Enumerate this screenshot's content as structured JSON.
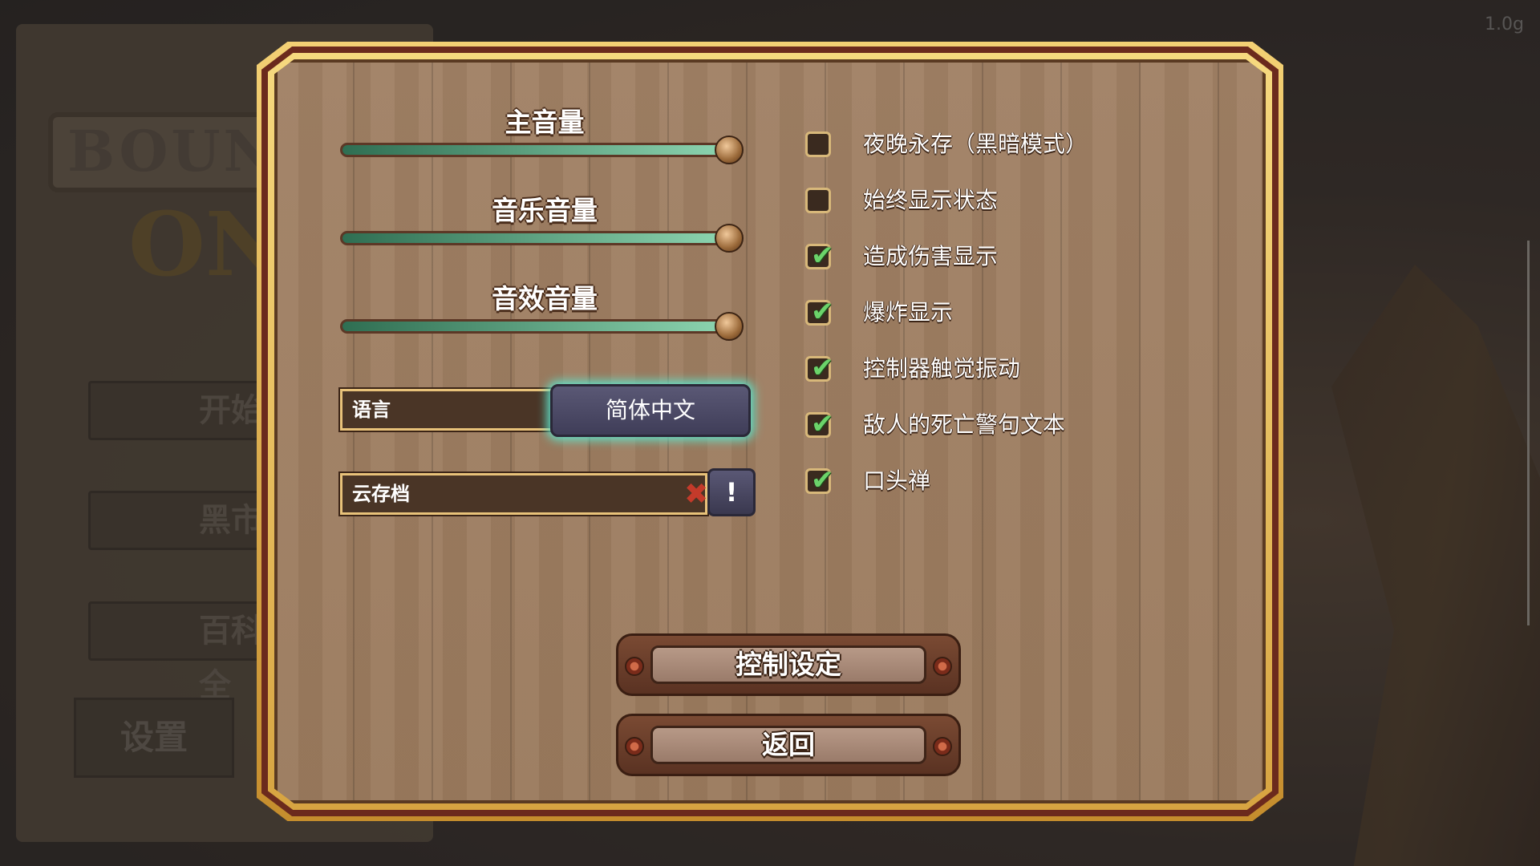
{
  "background": {
    "logo_text": "BOUN",
    "logo_sub": "ON",
    "menu_items": [
      "开始",
      "黑市",
      "百科全"
    ],
    "settings_label": "设置",
    "version": "1.0g"
  },
  "volume": {
    "master": {
      "label": "主音量",
      "level": 1.0
    },
    "music": {
      "label": "音乐音量",
      "level": 1.0
    },
    "sfx": {
      "label": "音效音量",
      "level": 1.0
    }
  },
  "language": {
    "label": "语言",
    "value": "简体中文"
  },
  "cloud_save": {
    "label": "云存档",
    "status_icon": "cross-icon",
    "info_label": "!"
  },
  "options": [
    {
      "label": "夜晚永存（黑暗模式）",
      "checked": false
    },
    {
      "label": "始终显示状态",
      "checked": false
    },
    {
      "label": "造成伤害显示",
      "checked": true
    },
    {
      "label": "爆炸显示",
      "checked": true
    },
    {
      "label": "控制器触觉振动",
      "checked": true
    },
    {
      "label": "敌人的死亡警句文本",
      "checked": true
    },
    {
      "label": "口头禅",
      "checked": true
    }
  ],
  "buttons": {
    "controls": "控制设定",
    "back": "返回"
  },
  "colors": {
    "frame_gold": "#f3d074",
    "slider_fill": "#8ed6b1",
    "check_green": "#6bd36a",
    "lang_glow": "#5fe1c9"
  }
}
